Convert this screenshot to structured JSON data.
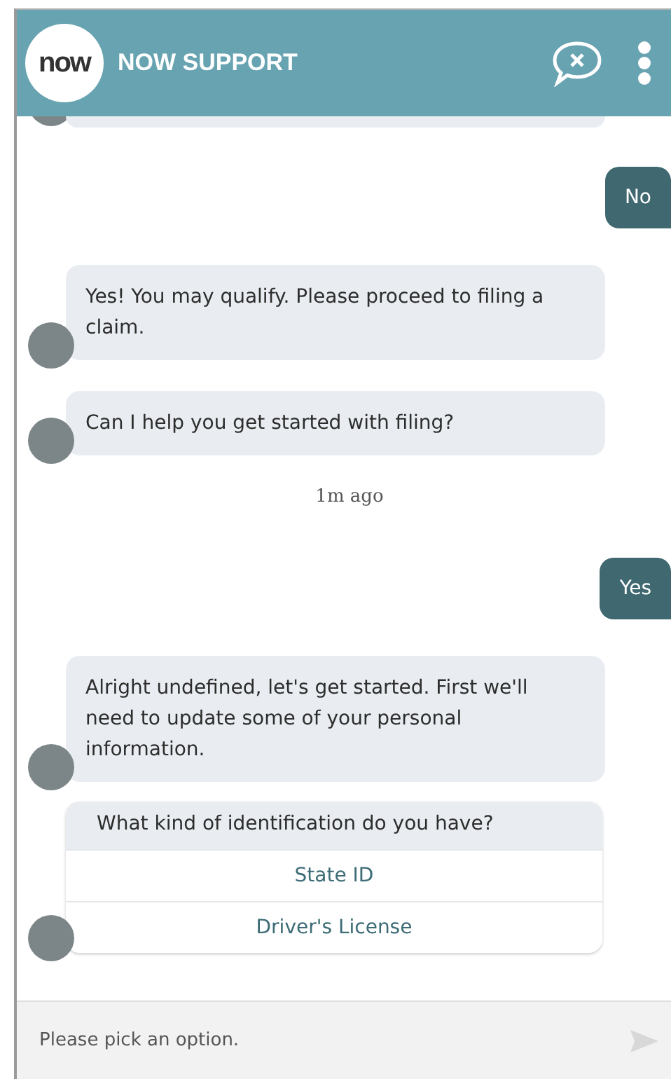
{
  "header": {
    "logo": "now",
    "title": "NOW SUPPORT"
  },
  "messages": [
    {
      "kind": "clipped"
    },
    {
      "kind": "user",
      "text": "No"
    },
    {
      "kind": "bot",
      "text": "Yes! You may qualify. Please proceed to filing a claim."
    },
    {
      "kind": "bot",
      "text": "Can I help you get started with filing?"
    },
    {
      "kind": "time",
      "text": "1m ago"
    },
    {
      "kind": "user",
      "text": "Yes"
    },
    {
      "kind": "bot",
      "text": "Alright undefined, let's get started. First we'll need to update some of your personal information."
    },
    {
      "kind": "choice",
      "text": "What kind of identification do you have?",
      "options": [
        "State ID",
        "Driver's License"
      ]
    }
  ],
  "input": {
    "placeholder": "Please pick an option."
  }
}
